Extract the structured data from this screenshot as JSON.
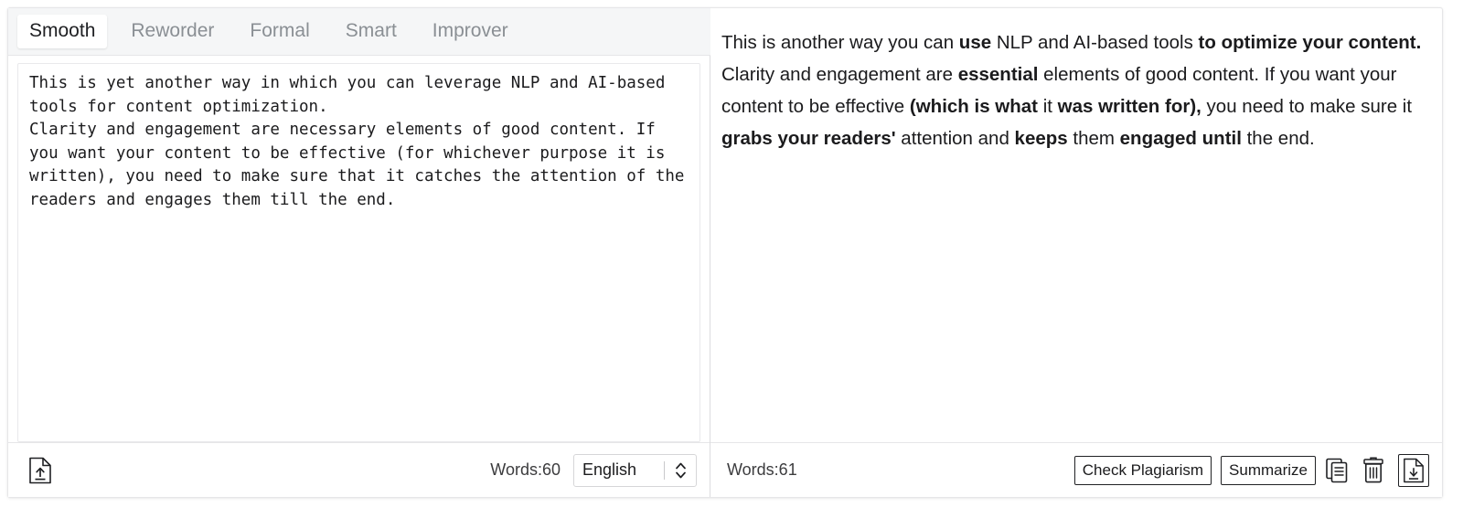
{
  "tabs": [
    {
      "label": "Smooth",
      "active": true
    },
    {
      "label": "Reworder",
      "active": false
    },
    {
      "label": "Formal",
      "active": false
    },
    {
      "label": "Smart",
      "active": false
    },
    {
      "label": "Improver",
      "active": false
    }
  ],
  "left_panel": {
    "source_text": "This is yet another way in which you can leverage NLP and AI-based tools for content optimization.\nClarity and engagement are necessary elements of good content. If you want your content to be effective (for whichever purpose it is written), you need to make sure that it catches the attention of the readers and engages them till the end.",
    "footer": {
      "word_count": "Words:60",
      "language": "English",
      "upload_icon": "document-upload-icon",
      "chevron_icon": "chevron-up-down-icon"
    }
  },
  "right_panel": {
    "output_runs": [
      {
        "text": "This is  another way  you can ",
        "bold": false
      },
      {
        "text": "use",
        "bold": true
      },
      {
        "text": " NLP and AI-based tools ",
        "bold": false
      },
      {
        "text": "to optimize your content.",
        "bold": true
      },
      {
        "text": "\n Clarity and engagement are ",
        "bold": false
      },
      {
        "text": "essential",
        "bold": true
      },
      {
        "text": " elements of good content. If you want your content to be effective ",
        "bold": false
      },
      {
        "text": "(which is what",
        "bold": true
      },
      {
        "text": " it ",
        "bold": false
      },
      {
        "text": "was written for),",
        "bold": true
      },
      {
        "text": " you need to make sure  it ",
        "bold": false
      },
      {
        "text": "grabs your readers'",
        "bold": true
      },
      {
        "text": " attention  and ",
        "bold": false
      },
      {
        "text": "keeps",
        "bold": true
      },
      {
        "text": " them ",
        "bold": false
      },
      {
        "text": "engaged until",
        "bold": true
      },
      {
        "text": " the end.",
        "bold": false
      }
    ],
    "footer": {
      "word_count": "Words:61",
      "check_plagiarism_label": "Check Plagiarism",
      "summarize_label": "Summarize",
      "copy_icon": "copy-icon",
      "delete_icon": "trash-icon",
      "download_icon": "document-download-icon"
    }
  },
  "colors": {
    "card_border": "#e6e6e8",
    "tabbar_bg": "#f5f6f7",
    "active_tab_text": "#202124",
    "inactive_tab_text": "#8a8f94",
    "body_text": "#1b1b1d",
    "button_border": "#202124"
  }
}
